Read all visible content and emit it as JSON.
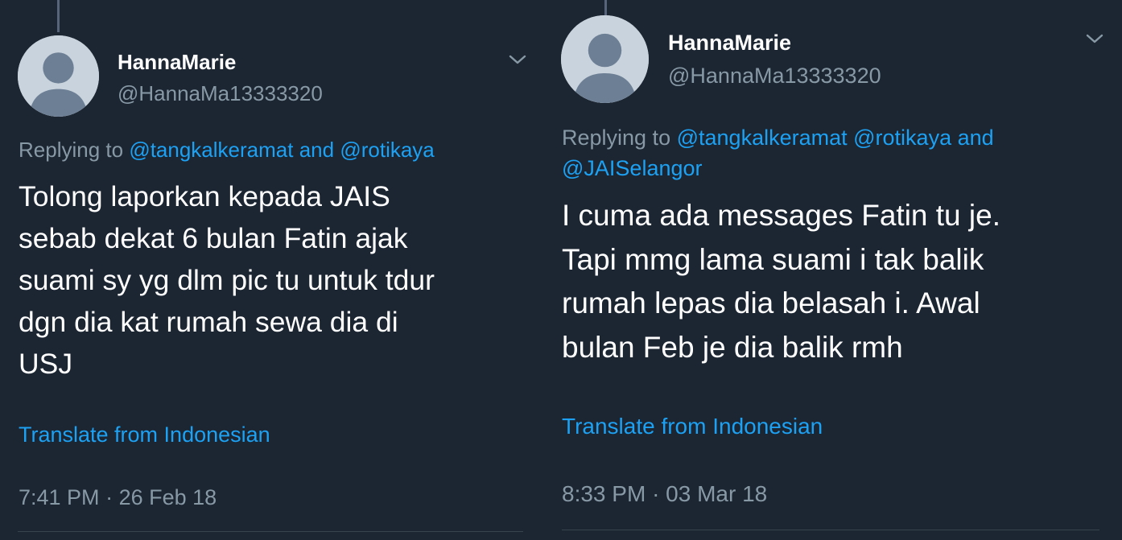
{
  "tweets": [
    {
      "user": {
        "name": "HannaMarie",
        "handle": "@HannaMa13333320"
      },
      "replying_prefix": "Replying to",
      "reply_mentions": [
        "@tangkalkeramat",
        "and",
        "@rotikaya"
      ],
      "text": "Tolong laporkan kepada JAIS\nsebab dekat 6 bulan Fatin ajak\nsuami sy yg dlm pic tu untuk tdur\ndgn dia kat rumah sewa dia di\nUSJ",
      "translate_label": "Translate from Indonesian",
      "time": "7:41 PM",
      "separator": "·",
      "date": "26 Feb 18"
    },
    {
      "user": {
        "name": "HannaMarie",
        "handle": "@HannaMa13333320"
      },
      "replying_prefix": "Replying to",
      "reply_mentions": [
        "@tangkalkeramat",
        "@rotikaya",
        "and",
        "@JAISelangor"
      ],
      "text": "I cuma ada messages Fatin tu je.\nTapi mmg lama suami i tak balik\nrumah lepas dia belasah i. Awal\nbulan Feb je dia balik rmh",
      "translate_label": "Translate from Indonesian",
      "time": "8:33 PM",
      "separator": "·",
      "date": "03 Mar 18"
    }
  ]
}
